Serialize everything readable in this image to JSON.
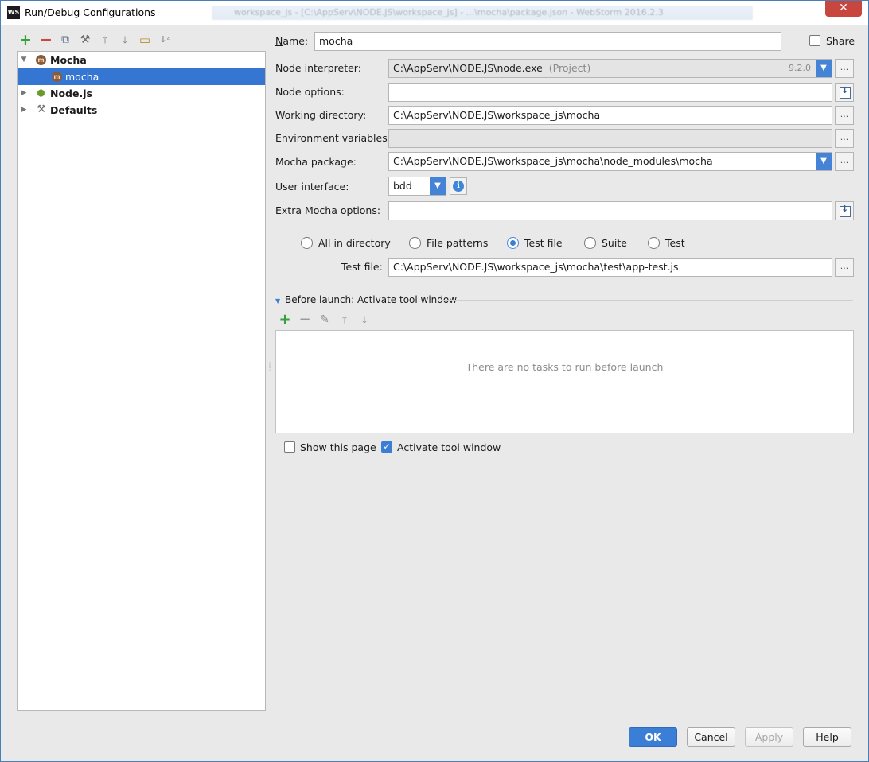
{
  "window": {
    "title": "Run/Debug Configurations",
    "logo_text": "WS",
    "background_title": "workspace_js - [C:\\AppServ\\NODE.JS\\workspace_js] - ...\\mocha\\package.json - WebStorm 2016.2.3",
    "close_glyph": "✕"
  },
  "toolbar": {
    "add": "+",
    "remove": "−",
    "copy": "⧉",
    "edit_defaults": "⚒",
    "move_up": "🡑",
    "move_down": "🡓",
    "folder": "▭",
    "sort": "↓ᶻ"
  },
  "tree": {
    "items": [
      {
        "label": "Mocha",
        "arrow": "▼",
        "icon": "m",
        "bold": true
      },
      {
        "label": "mocha",
        "icon": "m",
        "selected": true
      },
      {
        "label": "Node.js",
        "arrow": "▶",
        "icon": "⬢",
        "bold": true
      },
      {
        "label": "Defaults",
        "arrow": "▶",
        "icon": "⚒",
        "bold": true
      }
    ]
  },
  "form": {
    "name_label_first": "N",
    "name_label_rest": "ame:",
    "name_value": "mocha",
    "share_label": "Share",
    "share_checked": false,
    "node_interpreter_label": "Node interpreter:",
    "node_interpreter_value": "C:\\AppServ\\NODE.JS\\node.exe",
    "node_interpreter_tag": "(Project)",
    "node_interpreter_version": "9.2.0",
    "node_options_label": "Node options:",
    "node_options_value": "",
    "working_directory_label": "Working directory:",
    "working_directory_value": "C:\\AppServ\\NODE.JS\\workspace_js\\mocha",
    "env_vars_label": "Environment variables:",
    "env_vars_value": "",
    "mocha_package_label": "Mocha package:",
    "mocha_package_value": "C:\\AppServ\\NODE.JS\\workspace_js\\mocha\\node_modules\\mocha",
    "user_interface_label": "User interface:",
    "user_interface_value": "bdd",
    "extra_options_label": "Extra Mocha options:",
    "extra_options_value": "",
    "browse_glyph": "...",
    "dropdown_glyph": "▼",
    "info_glyph": "i"
  },
  "scope": {
    "options": [
      {
        "label": "All in directory",
        "checked": false
      },
      {
        "label": "File patterns",
        "checked": false
      },
      {
        "label": "Test file",
        "checked": true
      },
      {
        "label": "Suite",
        "checked": false
      },
      {
        "label": "Test",
        "checked": false
      }
    ],
    "test_file_label": "Test file:",
    "test_file_value": "C:\\AppServ\\NODE.JS\\workspace_js\\mocha\\test\\app-test.js"
  },
  "before_launch": {
    "title": "Before launch: Activate tool window",
    "arrow": "▼",
    "add": "+",
    "remove": "−",
    "edit": "✎",
    "up": "🡑",
    "down": "🡓",
    "empty_text": "There are no tasks to run before launch",
    "show_this_page_label": "Show this page",
    "show_this_page_checked": false,
    "activate_tool_window_label": "Activate tool window",
    "activate_tool_window_checked": true,
    "check_glyph": "✓"
  },
  "buttons": {
    "ok": "OK",
    "cancel": "Cancel",
    "apply": "Apply",
    "help": "Help"
  },
  "colors": {
    "accent": "#3b7ed6",
    "selection": "#3676d3",
    "add_green": "#36a03a",
    "remove_red": "#d0443a"
  }
}
